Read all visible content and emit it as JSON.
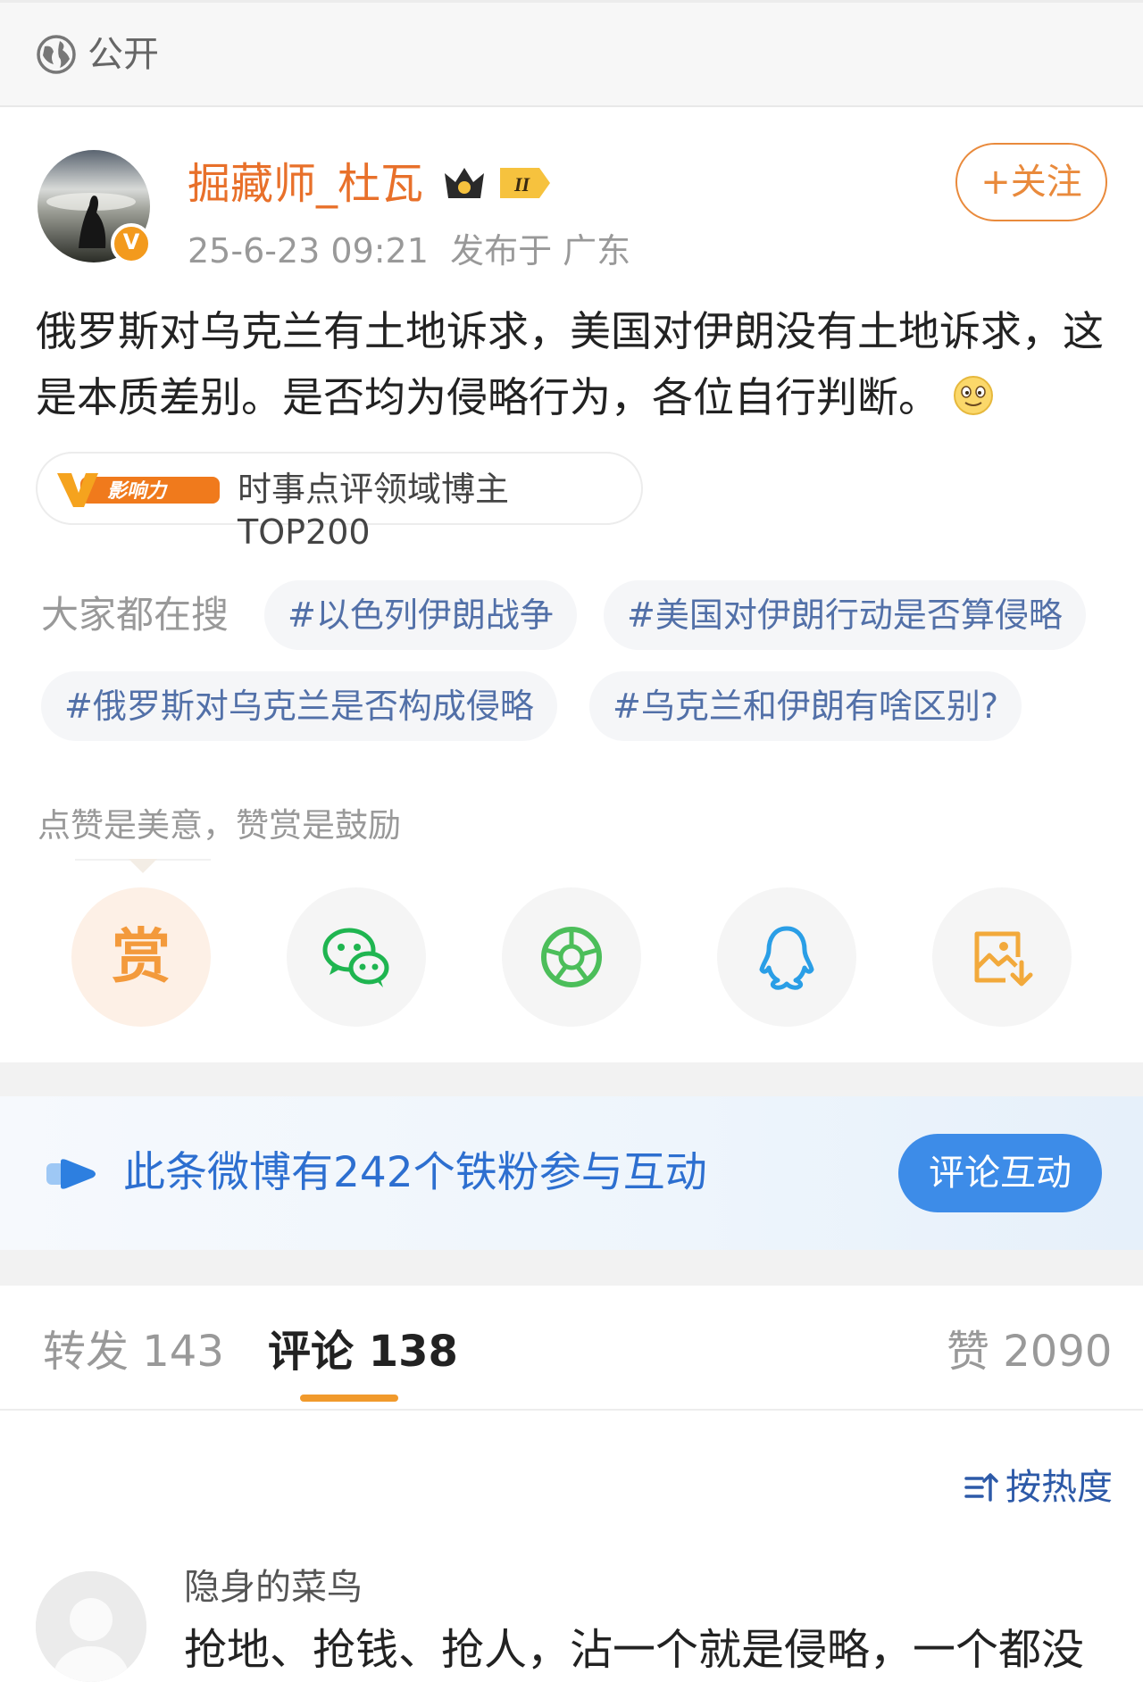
{
  "visibility": {
    "label": "公开",
    "icon": "globe-icon"
  },
  "author": {
    "name": "掘藏师_杜瓦",
    "level_badge": "II",
    "verified_mark": "V",
    "timestamp": "25-6-23 09:21",
    "location": "发布于 广东",
    "follow_label": "+关注",
    "name_color": "#e8702a"
  },
  "post": {
    "text": "俄罗斯对乌克兰有土地诉求，美国对伊朗没有土地诉求，这是本质差别。是否均为侵略行为，各位自行判断。",
    "emoji": "smile-emoji"
  },
  "influence_badge": {
    "logo_text": "影响力",
    "logo_letter": "V",
    "text": "时事点评领域博主TOP200"
  },
  "hot_search": {
    "label": "大家都在搜",
    "tags": [
      "#以色列伊朗战争",
      "#美国对伊朗行动是否算侵略",
      "#俄罗斯对乌克兰是否构成侵略",
      "#乌克兰和伊朗有啥区别?"
    ]
  },
  "reward_hint": "点赞是美意，赞赏是鼓励",
  "share_actions": [
    {
      "name": "reward",
      "label": "赏",
      "icon": "reward-icon"
    },
    {
      "name": "wechat",
      "icon": "wechat-icon"
    },
    {
      "name": "moments",
      "icon": "wechat-moments-icon"
    },
    {
      "name": "qq",
      "icon": "qq-icon"
    },
    {
      "name": "save-image",
      "icon": "save-image-icon"
    }
  ],
  "fans_interaction": {
    "text": "此条微博有242个铁粉参与互动",
    "button_label": "评论互动",
    "accent": "#3d8ce8"
  },
  "tabs": {
    "repost": "转发 143",
    "comments": "评论 138",
    "likes": "赞 2090",
    "active": "comments",
    "underline_color": "#f19a2c"
  },
  "sort": {
    "label": "按热度",
    "icon": "sort-icon"
  },
  "comments": [
    {
      "author": "隐身的菜鸟",
      "text": "抢地、抢钱、抢人，沾一个就是侵略，一个都没"
    }
  ]
}
